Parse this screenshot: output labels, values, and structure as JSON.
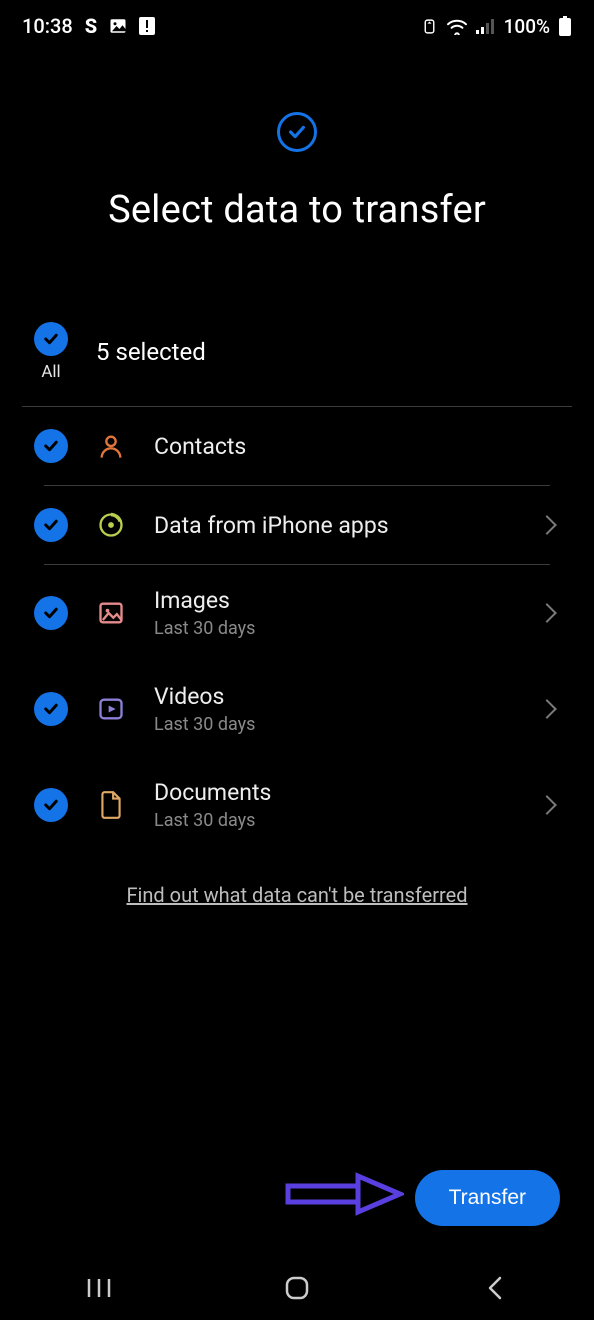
{
  "status": {
    "time": "10:38",
    "battery_pct": "100%"
  },
  "header": {
    "title": "Select data to transfer"
  },
  "select_all": {
    "label": "All",
    "count_text": "5 selected"
  },
  "items": [
    {
      "label": "Contacts",
      "sub": "",
      "icon": "contact-icon",
      "color": "#e0763a",
      "chevron": false
    },
    {
      "label": "Data from iPhone apps",
      "sub": "",
      "icon": "appdata-icon",
      "color": "#b8cf4e",
      "chevron": true
    },
    {
      "label": "Images",
      "sub": "Last 30 days",
      "icon": "image-icon",
      "color": "#e68b8b",
      "chevron": true
    },
    {
      "label": "Videos",
      "sub": "Last 30 days",
      "icon": "video-icon",
      "color": "#8b7fd6",
      "chevron": true
    },
    {
      "label": "Documents",
      "sub": "Last 30 days",
      "icon": "document-icon",
      "color": "#e0a864",
      "chevron": true
    }
  ],
  "footer": {
    "link_text": "Find out what data can't be transferred"
  },
  "button": {
    "transfer_label": "Transfer"
  }
}
